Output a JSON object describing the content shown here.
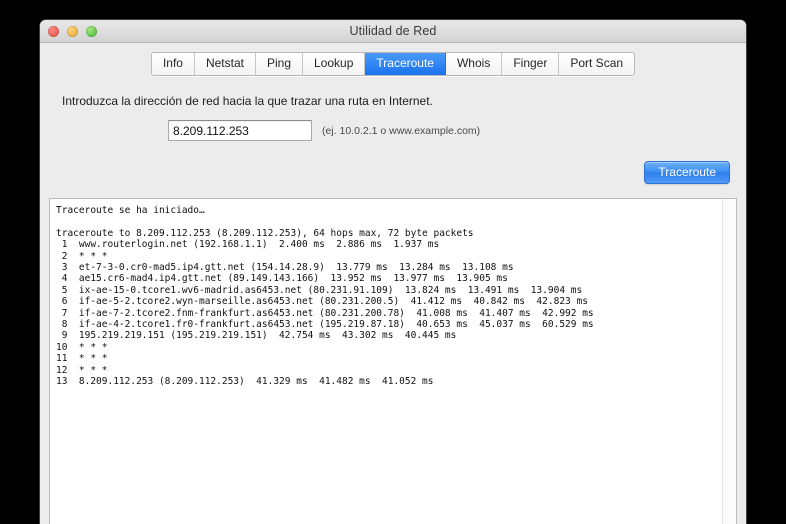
{
  "window": {
    "title": "Utilidad de Red",
    "traffic_lights": [
      "close",
      "minimize",
      "maximize"
    ]
  },
  "tabs": [
    {
      "label": "Info",
      "active": false
    },
    {
      "label": "Netstat",
      "active": false
    },
    {
      "label": "Ping",
      "active": false
    },
    {
      "label": "Lookup",
      "active": false
    },
    {
      "label": "Traceroute",
      "active": true
    },
    {
      "label": "Whois",
      "active": false
    },
    {
      "label": "Finger",
      "active": false
    },
    {
      "label": "Port Scan",
      "active": false
    }
  ],
  "form": {
    "instruction": "Introduzca la dirección de red hacia la que trazar una ruta en Internet.",
    "address_value": "8.209.112.253",
    "address_placeholder": "8.209.112.253",
    "address_hint": "(ej. 10.0.2.1 o www.example.com)",
    "action_button": "Traceroute"
  },
  "output": {
    "lines": [
      "Traceroute se ha iniciado…",
      "",
      "traceroute to 8.209.112.253 (8.209.112.253), 64 hops max, 72 byte packets",
      " 1  www.routerlogin.net (192.168.1.1)  2.400 ms  2.886 ms  1.937 ms",
      " 2  * * *",
      " 3  et-7-3-0.cr0-mad5.ip4.gtt.net (154.14.28.9)  13.779 ms  13.284 ms  13.108 ms",
      " 4  ae15.cr6-mad4.ip4.gtt.net (89.149.143.166)  13.952 ms  13.977 ms  13.905 ms",
      " 5  ix-ae-15-0.tcore1.wv6-madrid.as6453.net (80.231.91.109)  13.824 ms  13.491 ms  13.904 ms",
      " 6  if-ae-5-2.tcore2.wyn-marseille.as6453.net (80.231.200.5)  41.412 ms  40.842 ms  42.823 ms",
      " 7  if-ae-7-2.tcore2.fnm-frankfurt.as6453.net (80.231.200.78)  41.008 ms  41.407 ms  42.992 ms",
      " 8  if-ae-4-2.tcore1.fr0-frankfurt.as6453.net (195.219.87.18)  40.653 ms  45.037 ms  60.529 ms",
      " 9  195.219.219.151 (195.219.219.151)  42.754 ms  43.302 ms  40.445 ms",
      "10  * * *",
      "11  * * *",
      "12  * * *",
      "13  8.209.112.253 (8.209.112.253)  41.329 ms  41.482 ms  41.052 ms"
    ],
    "text": "Traceroute se ha iniciado…\n\ntraceroute to 8.209.112.253 (8.209.112.253), 64 hops max, 72 byte packets\n 1  www.routerlogin.net (192.168.1.1)  2.400 ms  2.886 ms  1.937 ms\n 2  * * *\n 3  et-7-3-0.cr0-mad5.ip4.gtt.net (154.14.28.9)  13.779 ms  13.284 ms  13.108 ms\n 4  ae15.cr6-mad4.ip4.gtt.net (89.149.143.166)  13.952 ms  13.977 ms  13.905 ms\n 5  ix-ae-15-0.tcore1.wv6-madrid.as6453.net (80.231.91.109)  13.824 ms  13.491 ms  13.904 ms\n 6  if-ae-5-2.tcore2.wyn-marseille.as6453.net (80.231.200.5)  41.412 ms  40.842 ms  42.823 ms\n 7  if-ae-7-2.tcore2.fnm-frankfurt.as6453.net (80.231.200.78)  41.008 ms  41.407 ms  42.992 ms\n 8  if-ae-4-2.tcore1.fr0-frankfurt.as6453.net (195.219.87.18)  40.653 ms  45.037 ms  60.529 ms\n 9  195.219.219.151 (195.219.219.151)  42.754 ms  43.302 ms  40.445 ms\n10  * * *\n11  * * *\n12  * * *\n13  8.209.112.253 (8.209.112.253)  41.329 ms  41.482 ms  41.052 ms"
  },
  "colors": {
    "accent": "#2f7ff0",
    "window_bg": "#ececec",
    "output_bg": "#ffffff",
    "title_text": "#3b3b3b"
  }
}
